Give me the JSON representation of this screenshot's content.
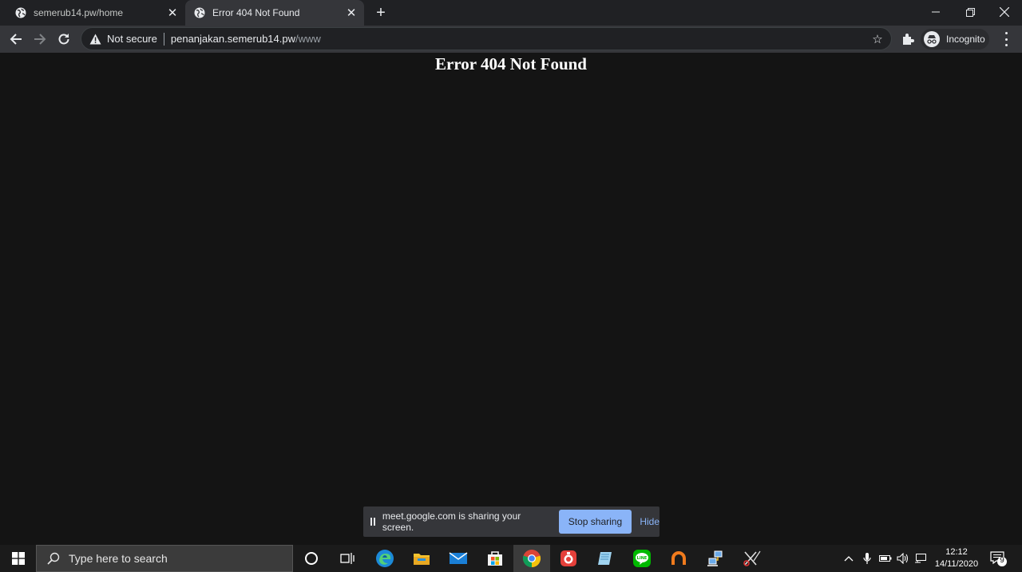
{
  "browser": {
    "tabs": [
      {
        "title": "semerub14.pw/home",
        "active": false
      },
      {
        "title": "Error 404 Not Found",
        "active": true
      }
    ],
    "address": {
      "security_label": "Not secure",
      "host": "penanjakan.semerub14.pw",
      "path": "/www"
    },
    "profile_label": "Incognito"
  },
  "page": {
    "heading": "Error 404 Not Found"
  },
  "share_bar": {
    "message": "meet.google.com is sharing your screen.",
    "stop_label": "Stop sharing",
    "hide_label": "Hide"
  },
  "taskbar": {
    "search_placeholder": "Type here to search",
    "time": "12:12",
    "date": "14/11/2020",
    "notification_count": "9",
    "pinned_icons": [
      "cortana-icon",
      "task-view-icon",
      "edge-icon",
      "file-explorer-icon",
      "mail-icon",
      "store-icon",
      "chrome-icon",
      "app-red-icon",
      "notes-icon",
      "line-icon",
      "orange-app-icon",
      "network-app-icon",
      "snipping-tool-icon"
    ]
  },
  "colors": {
    "page_bg": "#141414",
    "tab_strip": "#202124",
    "toolbar": "#35363a",
    "accent": "#8ab4f8"
  }
}
